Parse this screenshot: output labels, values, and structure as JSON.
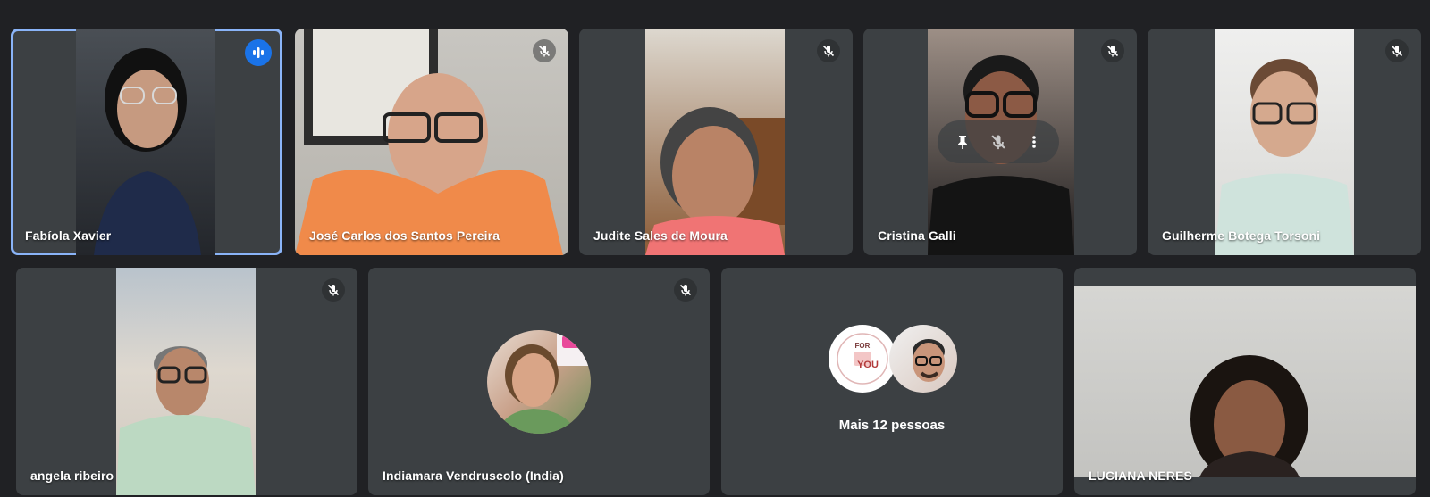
{
  "participants_top": [
    {
      "name": "Fabíola Xavier",
      "speaking": true
    },
    {
      "name": "José Carlos dos Santos Pereira",
      "muted": true
    },
    {
      "name": "Judite Sales de Moura",
      "muted": true
    },
    {
      "name": "Cristina Galli",
      "muted": true
    },
    {
      "name": "Guilherme Botega Torsoni",
      "muted": true
    }
  ],
  "participants_bottom": [
    {
      "name": "angela ribeiro",
      "muted": true
    },
    {
      "name": "Indiamara Vendruscolo (India)",
      "muted": true
    },
    {
      "more_label": "Mais 12 pessoas",
      "avatar_text": {
        "line1": "FOR",
        "line2": "YOU"
      }
    },
    {
      "name": "LUCIANA NERES"
    }
  ],
  "icons": {
    "muted": "mic-off-icon",
    "speaking": "audio-level-icon",
    "pin": "pin-icon",
    "more": "more-vert-icon"
  },
  "colors": {
    "background": "#202124",
    "tile": "#3c4043",
    "speaking_border": "#8ab4f8",
    "speaking_badge": "#1a73e8"
  }
}
